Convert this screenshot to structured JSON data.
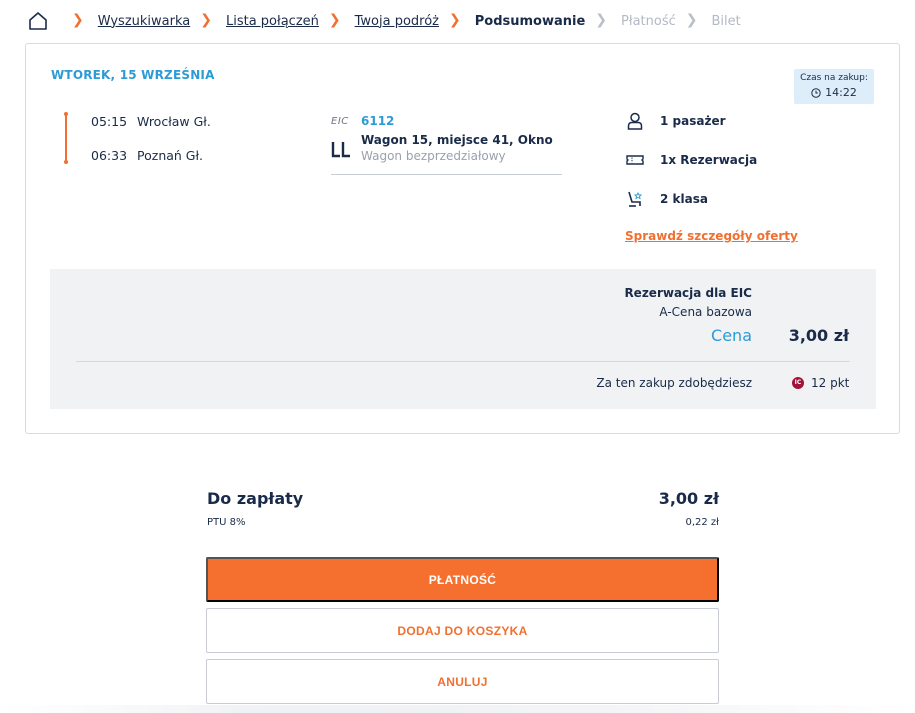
{
  "breadcrumb": {
    "home_icon": "home-icon",
    "items": [
      {
        "label": "Wyszukiwarka",
        "state": "link"
      },
      {
        "label": "Lista połączeń",
        "state": "link"
      },
      {
        "label": "Twoja podróż",
        "state": "link"
      },
      {
        "label": "Podsumowanie",
        "state": "active"
      },
      {
        "label": "Płatność",
        "state": "disabled"
      },
      {
        "label": "Bilet",
        "state": "disabled"
      }
    ]
  },
  "journey": {
    "date": "WTOREK, 15 WRZEŚNIA",
    "timer": {
      "label": "Czas na zakup:",
      "value": "14:22"
    },
    "departure": {
      "time": "05:15",
      "station": "Wrocław Gł."
    },
    "arrival": {
      "time": "06:33",
      "station": "Poznań Gł."
    },
    "train": {
      "carrier": "EIC",
      "number": "6112",
      "seat": "Wagon 15, miejsce 41, Okno",
      "wagon_type": "Wagon bezprzedziałowy"
    },
    "features": [
      {
        "icon": "passenger-icon",
        "label": "1 pasażer"
      },
      {
        "icon": "ticket-icon",
        "label": "1x Rezerwacja"
      },
      {
        "icon": "class-seat-icon",
        "label": "2 klasa"
      }
    ],
    "offer_link": "Sprawdź szczegóły oferty"
  },
  "pricing": {
    "title": "Rezerwacja dla EIC",
    "tariff": "A-Cena bazowa",
    "price_label": "Cena",
    "price_value": "3,00 zł",
    "points_label": "Za ten zakup zdobędziesz",
    "points_badge": "IC",
    "points_value": "12 pkt"
  },
  "summary": {
    "title": "Do zapłaty",
    "total": "3,00 zł",
    "tax_label": "PTU 8%",
    "tax_value": "0,22 zł"
  },
  "buttons": {
    "pay": "PŁATNOŚĆ",
    "add_to_cart": "DODAJ DO KOSZYKA",
    "cancel": "ANULUJ"
  },
  "colors": {
    "accent_orange": "#f5702f",
    "accent_blue": "#2d9bd5",
    "text_navy": "#1a2b49"
  }
}
